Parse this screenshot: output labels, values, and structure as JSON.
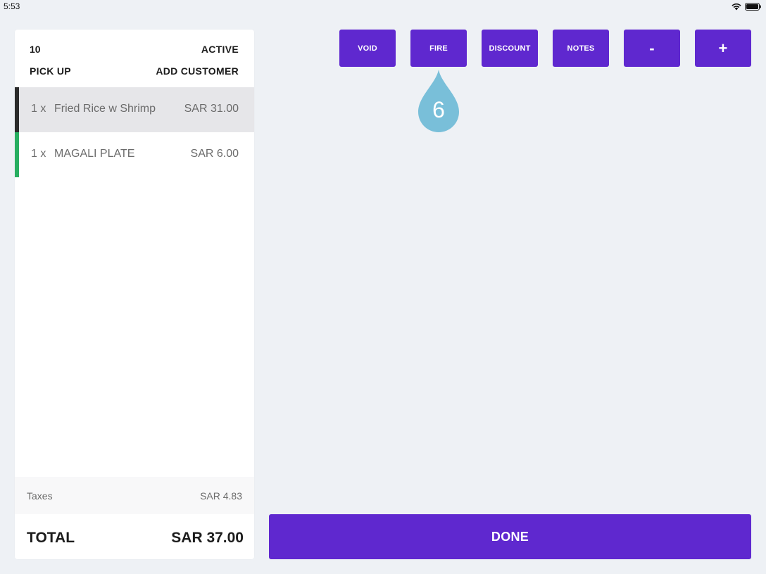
{
  "status_bar": {
    "time": "5:53"
  },
  "order": {
    "number": "10",
    "status": "ACTIVE",
    "type": "PICK UP",
    "add_customer_label": "ADD CUSTOMER",
    "items": [
      {
        "qty": "1  x",
        "name": "Fried Rice w Shrimp",
        "price": "SAR 31.00",
        "selected": true,
        "accent_color": "#2b2b2b"
      },
      {
        "qty": "1  x",
        "name": "MAGALI PLATE",
        "price": "SAR 6.00",
        "selected": false,
        "accent_color": "#27ae60"
      }
    ],
    "taxes_label": "Taxes",
    "taxes_value": "SAR 4.83",
    "total_label": "TOTAL",
    "total_value": "SAR 37.00"
  },
  "actions": {
    "void": "VOID",
    "fire": "FIRE",
    "discount": "DISCOUNT",
    "notes": "NOTES",
    "minus": "-",
    "plus": "+"
  },
  "step_marker": {
    "number": "6",
    "color": "#79bfd9"
  },
  "done_label": "DONE",
  "colors": {
    "primary": "#5f28cf",
    "background": "#eef1f5",
    "selected_row": "#e6e6e9"
  },
  "icons": {
    "wifi": "wifi-icon",
    "battery": "battery-icon"
  }
}
